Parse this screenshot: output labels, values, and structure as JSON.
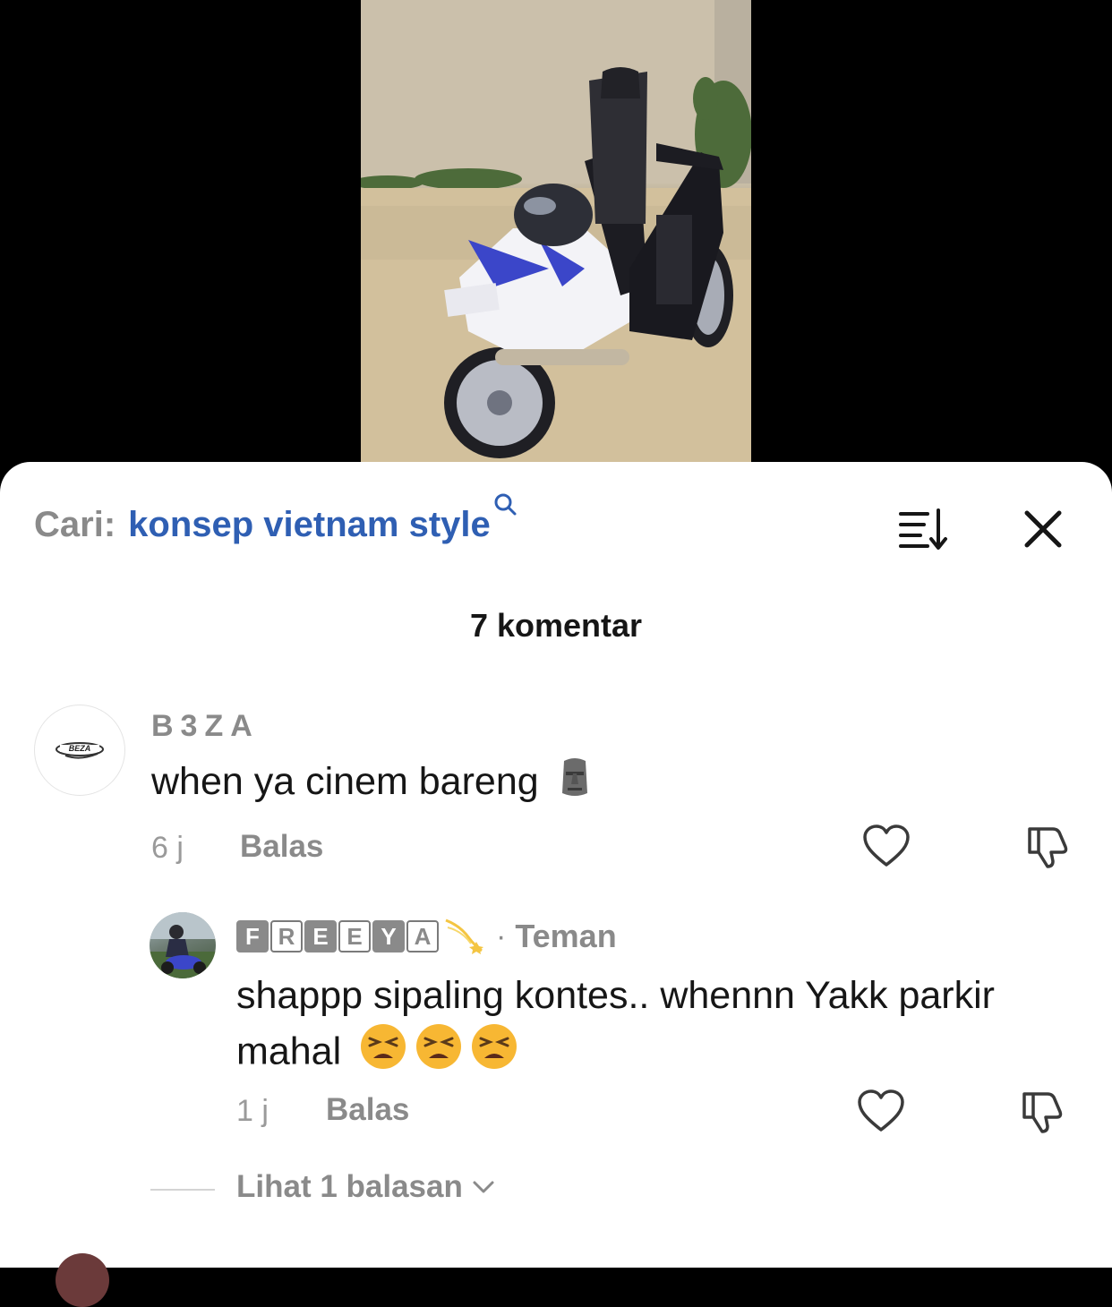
{
  "search": {
    "prefix": "Cari:",
    "term": "konsep vietnam style"
  },
  "icons": {
    "search": "search-icon",
    "sort": "sort-icon",
    "close": "close-icon",
    "like": "heart-icon",
    "dislike": "thumbs-down-icon",
    "expand": "chevron-down-icon"
  },
  "comments_header": {
    "count_label": "7 komentar"
  },
  "comments": [
    {
      "username": "B3ZA",
      "text": "when ya cinem bareng",
      "emoji": "moai-emoji",
      "time": "6 j",
      "reply_label": "Balas"
    }
  ],
  "reply": {
    "username_tiles": [
      "F",
      "R",
      "E",
      "E",
      "Y",
      "A"
    ],
    "username_emoji": "dizzy-emoji",
    "separator": "·",
    "relation": "Teman",
    "text": "shappp sipaling kontes.. whennn Yakk parkir mahal",
    "emojis": [
      "tired-face-emoji",
      "tired-face-emoji",
      "tired-face-emoji"
    ],
    "time": "1 j",
    "reply_label": "Balas"
  },
  "more_replies_label": "Lihat 1 balasan",
  "colors": {
    "accent_blue": "#2f5fb3",
    "muted_text": "#8a8a8a",
    "primary_text": "#161616"
  }
}
